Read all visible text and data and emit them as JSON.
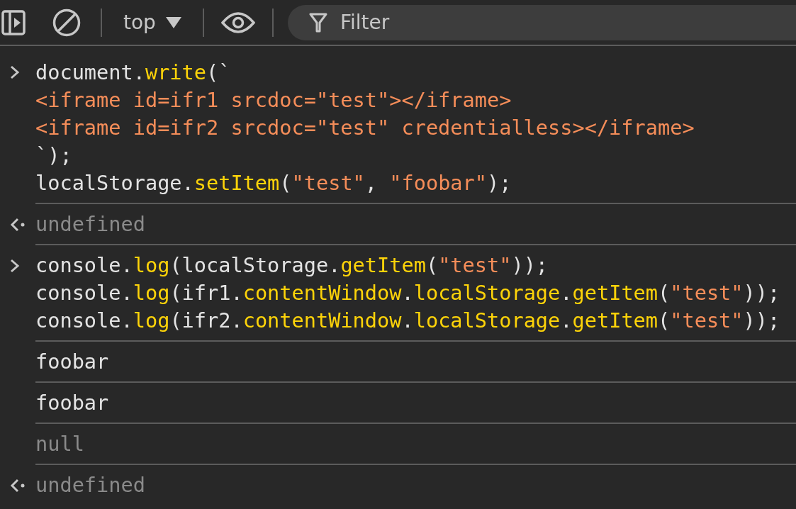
{
  "toolbar": {
    "context": "top",
    "filter": {
      "placeholder": "Filter"
    }
  },
  "entries": [
    {
      "kind": "input",
      "lines": [
        [
          {
            "kind": "plain",
            "t": "document."
          },
          {
            "kind": "method",
            "t": "write"
          },
          {
            "kind": "plain",
            "t": "(`"
          }
        ],
        [
          {
            "kind": "string",
            "t": "<iframe id=ifr1 srcdoc=\"test\"></iframe>"
          }
        ],
        [
          {
            "kind": "string",
            "t": "<iframe id=ifr2 srcdoc=\"test\" credentialless></iframe>"
          }
        ],
        [
          {
            "kind": "plain",
            "t": "`);"
          }
        ],
        [
          {
            "kind": "plain",
            "t": "localStorage."
          },
          {
            "kind": "method",
            "t": "setItem"
          },
          {
            "kind": "plain",
            "t": "("
          },
          {
            "kind": "string",
            "t": "\"test\""
          },
          {
            "kind": "plain",
            "t": ", "
          },
          {
            "kind": "string",
            "t": "\"foobar\""
          },
          {
            "kind": "plain",
            "t": ");"
          }
        ]
      ]
    },
    {
      "kind": "result",
      "text": "undefined"
    },
    {
      "kind": "input",
      "lines": [
        [
          {
            "kind": "plain",
            "t": "console."
          },
          {
            "kind": "method",
            "t": "log"
          },
          {
            "kind": "plain",
            "t": "(localStorage."
          },
          {
            "kind": "method",
            "t": "getItem"
          },
          {
            "kind": "plain",
            "t": "("
          },
          {
            "kind": "string",
            "t": "\"test\""
          },
          {
            "kind": "plain",
            "t": "));"
          }
        ],
        [
          {
            "kind": "plain",
            "t": "console."
          },
          {
            "kind": "method",
            "t": "log"
          },
          {
            "kind": "plain",
            "t": "(ifr1."
          },
          {
            "kind": "method",
            "t": "contentWindow"
          },
          {
            "kind": "plain",
            "t": "."
          },
          {
            "kind": "method",
            "t": "localStorage"
          },
          {
            "kind": "plain",
            "t": "."
          },
          {
            "kind": "method",
            "t": "getItem"
          },
          {
            "kind": "plain",
            "t": "("
          },
          {
            "kind": "string",
            "t": "\"test\""
          },
          {
            "kind": "plain",
            "t": "));"
          }
        ],
        [
          {
            "kind": "plain",
            "t": "console."
          },
          {
            "kind": "method",
            "t": "log"
          },
          {
            "kind": "plain",
            "t": "(ifr2."
          },
          {
            "kind": "method",
            "t": "contentWindow"
          },
          {
            "kind": "plain",
            "t": "."
          },
          {
            "kind": "method",
            "t": "localStorage"
          },
          {
            "kind": "plain",
            "t": "."
          },
          {
            "kind": "method",
            "t": "getItem"
          },
          {
            "kind": "plain",
            "t": "("
          },
          {
            "kind": "string",
            "t": "\"test\""
          },
          {
            "kind": "plain",
            "t": "));"
          }
        ]
      ]
    },
    {
      "kind": "log",
      "text": "foobar",
      "muted": false
    },
    {
      "kind": "log",
      "text": "foobar",
      "muted": false
    },
    {
      "kind": "log",
      "text": "null",
      "muted": true
    },
    {
      "kind": "result",
      "text": "undefined"
    }
  ]
}
